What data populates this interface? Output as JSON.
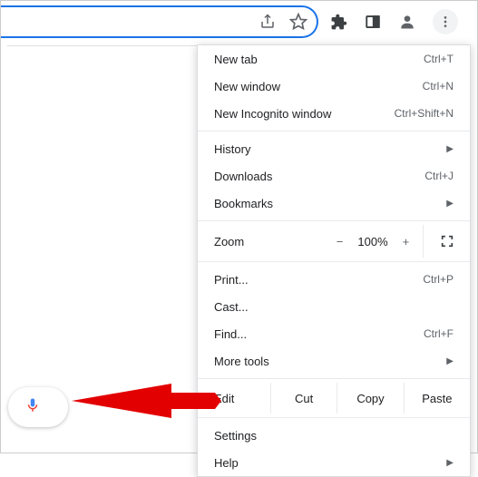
{
  "toolbar": {
    "share_icon": "share-icon",
    "star_icon": "star-icon",
    "extensions_icon": "puzzle-icon",
    "sidepanel_icon": "panel-icon",
    "profile_icon": "profile-icon",
    "menu_icon": "kebab-icon"
  },
  "mic_icon": "microphone-icon",
  "menu": {
    "group1": [
      {
        "label": "New tab",
        "accel": "Ctrl+T"
      },
      {
        "label": "New window",
        "accel": "Ctrl+N"
      },
      {
        "label": "New Incognito window",
        "accel": "Ctrl+Shift+N"
      }
    ],
    "group2": [
      {
        "label": "History",
        "submenu": true
      },
      {
        "label": "Downloads",
        "accel": "Ctrl+J"
      },
      {
        "label": "Bookmarks",
        "submenu": true
      }
    ],
    "zoom": {
      "label": "Zoom",
      "minus": "−",
      "value": "100%",
      "plus": "+"
    },
    "group3": [
      {
        "label": "Print...",
        "accel": "Ctrl+P"
      },
      {
        "label": "Cast..."
      },
      {
        "label": "Find...",
        "accel": "Ctrl+F"
      },
      {
        "label": "More tools",
        "submenu": true
      }
    ],
    "edit": {
      "label": "Edit",
      "cut": "Cut",
      "copy": "Copy",
      "paste": "Paste"
    },
    "group4": [
      {
        "label": "Settings"
      },
      {
        "label": "Help",
        "submenu": true
      }
    ]
  }
}
